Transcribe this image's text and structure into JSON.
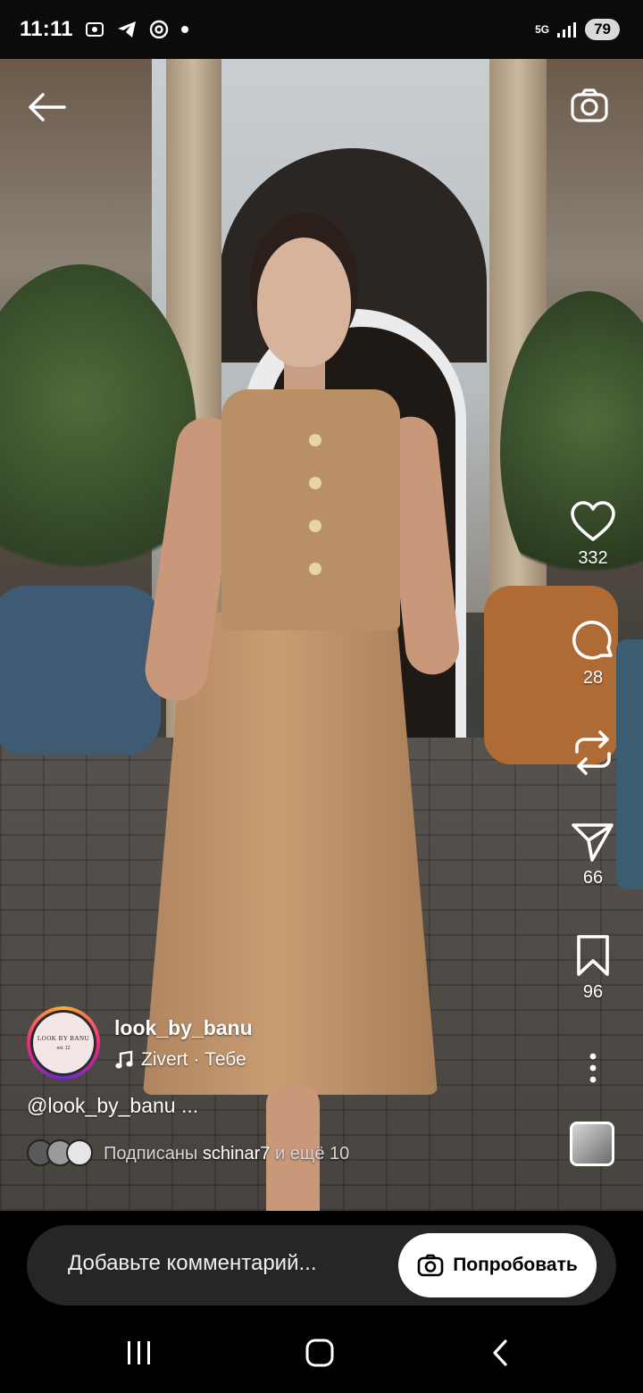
{
  "status_bar": {
    "time": "11:11",
    "network": "5G",
    "battery": "79"
  },
  "post": {
    "likes": "332",
    "comments": "28",
    "shares": "66",
    "saves": "96",
    "username": "look_by_banu",
    "music_artist": "Zivert",
    "music_separator": " · ",
    "music_subtitle": "Тебе",
    "caption": "@look_by_banu ...",
    "avatar_logo_text": "LOOK BY BANU",
    "avatar_sub_text": "est. 12",
    "followed_prefix": "Подписаны ",
    "followed_user": "schinar7",
    "followed_suffix": " и ещё 10"
  },
  "comment_bar": {
    "placeholder": "Добавьте комментарий...",
    "try_label": "Попробовать"
  },
  "colors": {
    "accent_story_ring": "#ee2a7b",
    "comment_pill": "#262626",
    "background": "#000000"
  },
  "icons": [
    "back-arrow-icon",
    "camera-icon",
    "heart-icon",
    "comment-icon",
    "repost-icon",
    "send-icon",
    "bookmark-icon",
    "more-icon",
    "music-note-icon",
    "camera-small-icon",
    "recents-icon",
    "home-icon",
    "back-icon"
  ]
}
